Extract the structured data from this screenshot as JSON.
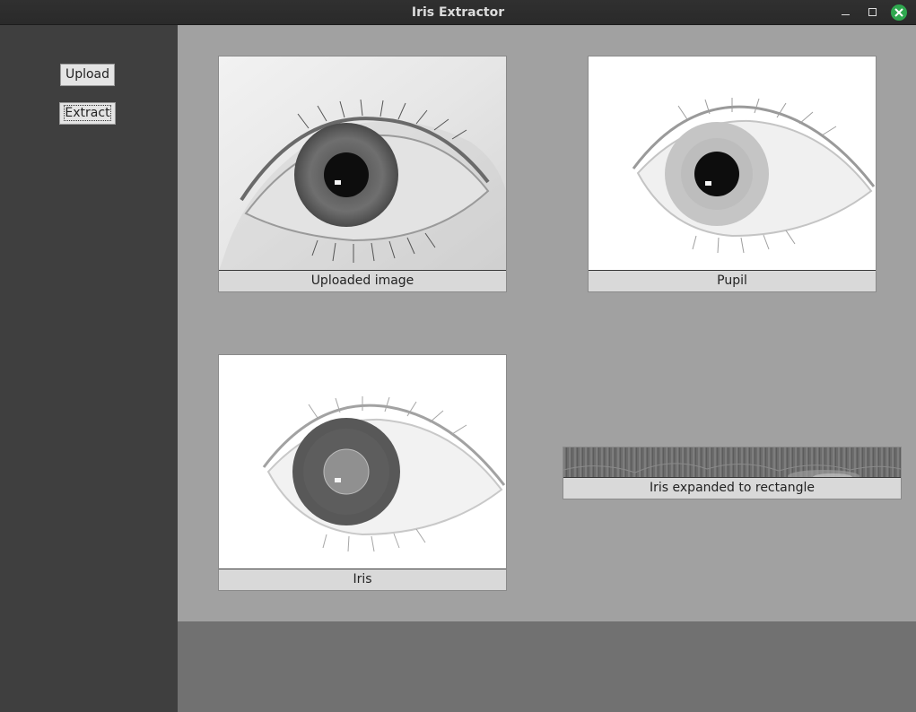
{
  "window": {
    "title": "Iris Extractor",
    "controls": [
      "minimize-icon",
      "maximize-icon",
      "close-icon"
    ],
    "close_color": "#2fa84f"
  },
  "sidebar": {
    "upload_label": "Upload",
    "extract_label": "Extract"
  },
  "panels": {
    "uploaded": {
      "caption": "Uploaded image"
    },
    "pupil": {
      "caption": "Pupil"
    },
    "iris": {
      "caption": "Iris"
    },
    "rect": {
      "caption": "Iris expanded to rectangle"
    }
  },
  "colors": {
    "sidebar_bg": "#3f3f3f",
    "canvas_bg": "#a1a1a1",
    "caption_bg": "#d9d9d9"
  }
}
